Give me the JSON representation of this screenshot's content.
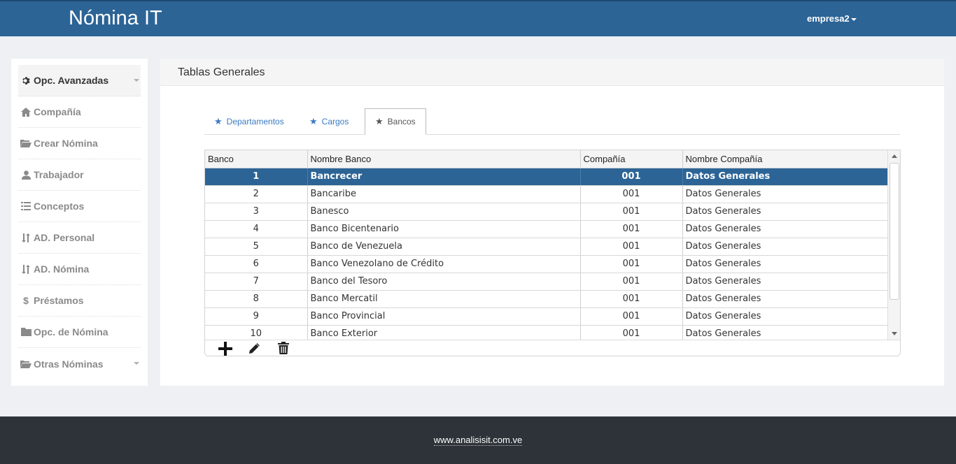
{
  "header": {
    "brand": "Nómina IT",
    "user": "empresa2"
  },
  "sidebar": {
    "items": [
      {
        "label": "Opc. Avanzadas",
        "icon": "gear-icon"
      },
      {
        "label": "Compañía",
        "icon": "home-icon"
      },
      {
        "label": "Crear Nómina",
        "icon": "folder-open-icon"
      },
      {
        "label": "Trabajador",
        "icon": "user-icon"
      },
      {
        "label": "Conceptos",
        "icon": "list-icon"
      },
      {
        "label": "AD. Personal",
        "icon": "sort-icon"
      },
      {
        "label": "AD. Nómina",
        "icon": "sort-icon"
      },
      {
        "label": "Préstamos",
        "icon": "dollar-icon"
      },
      {
        "label": "Opc. de Nómina",
        "icon": "folder-icon"
      },
      {
        "label": "Otras Nóminas",
        "icon": "folder-open-icon"
      }
    ]
  },
  "panel": {
    "title": "Tablas Generales"
  },
  "tabs": [
    {
      "label": "Departamentos"
    },
    {
      "label": "Cargos"
    },
    {
      "label": "Bancos"
    }
  ],
  "grid": {
    "columns": [
      "Banco",
      "Nombre Banco",
      "Compañía",
      "Nombre Compañía"
    ],
    "rows": [
      [
        "1",
        "Bancrecer",
        "001",
        "Datos Generales"
      ],
      [
        "2",
        "Bancaribe",
        "001",
        "Datos Generales"
      ],
      [
        "3",
        "Banesco",
        "001",
        "Datos Generales"
      ],
      [
        "4",
        "Banco Bicentenario",
        "001",
        "Datos Generales"
      ],
      [
        "5",
        "Banco de Venezuela",
        "001",
        "Datos Generales"
      ],
      [
        "6",
        "Banco Venezolano de Crédito",
        "001",
        "Datos Generales"
      ],
      [
        "7",
        "Banco del Tesoro",
        "001",
        "Datos Generales"
      ],
      [
        "8",
        "Banco Mercatil",
        "001",
        "Datos Generales"
      ],
      [
        "9",
        "Banco Provincial",
        "001",
        "Datos Generales"
      ],
      [
        "10",
        "Banco Exterior",
        "001",
        "Datos Generales"
      ]
    ]
  },
  "footer": {
    "link": "www.analisisit.com.ve"
  },
  "colors": {
    "primary": "#2c6496",
    "footer": "#2d3339",
    "tab_link": "#3a7ac0"
  }
}
